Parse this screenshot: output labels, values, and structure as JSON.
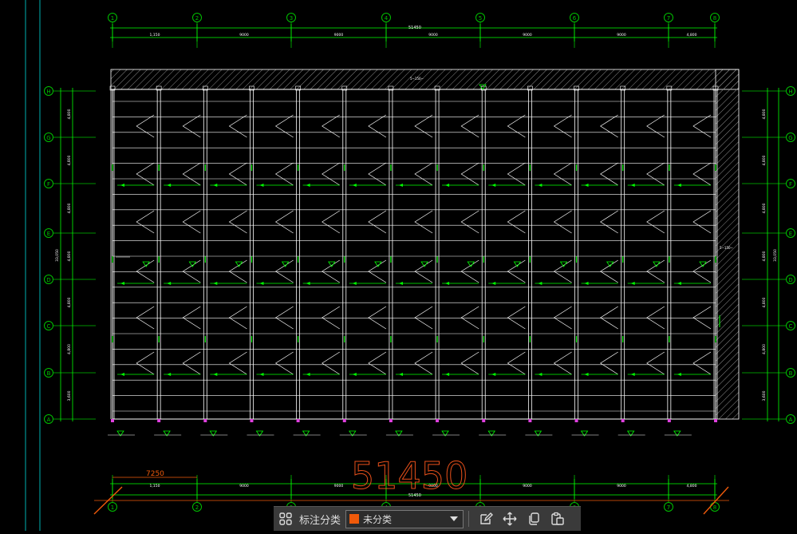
{
  "drawing": {
    "big_dimension_text": "51450",
    "segment_dimension_text": "7250",
    "overall_dimension_text": "51450",
    "top_segment_labels": [
      "1,150",
      "9000",
      "9000",
      "9000",
      "9000",
      "9000",
      "4,800"
    ],
    "bottom_segment_labels": [
      "1,150",
      "9000",
      "9000",
      "9000",
      "9000",
      "9000",
      "4,800"
    ],
    "column_axes": [
      "1",
      "2",
      "3",
      "4",
      "5",
      "6",
      "7",
      "8"
    ],
    "row_axes": [
      "H",
      "G",
      "F",
      "E",
      "D",
      "C",
      "B",
      "A"
    ],
    "left_row_dims": [
      "4,800",
      "4,800",
      "4,800",
      "4,800",
      "4,800",
      "4,800",
      "3,600"
    ],
    "left_overall_dim": "33,050",
    "right_row_dims": [
      "4,800",
      "4,800",
      "4,800",
      "4,800",
      "4,800",
      "4,800",
      "3,600"
    ],
    "right_overall_dim": "33,050",
    "top_note": "5∼150∼",
    "right_note": "5∼150∼",
    "colors": {
      "background": "#000000",
      "line": "#ffffff",
      "axis": "#00c000",
      "dimension": "#00ff00",
      "accent": "#f05a0a",
      "hatch": "#b0b0b0"
    }
  },
  "toolbar": {
    "grid_icon": "grid-icon",
    "label": "标注分类",
    "select_value": "未分类",
    "select_color": "#f05a0a",
    "edit_icon": "edit-icon",
    "move_icon": "move-icon",
    "copy_icon": "copy-icon",
    "paste_icon": "paste-icon"
  }
}
